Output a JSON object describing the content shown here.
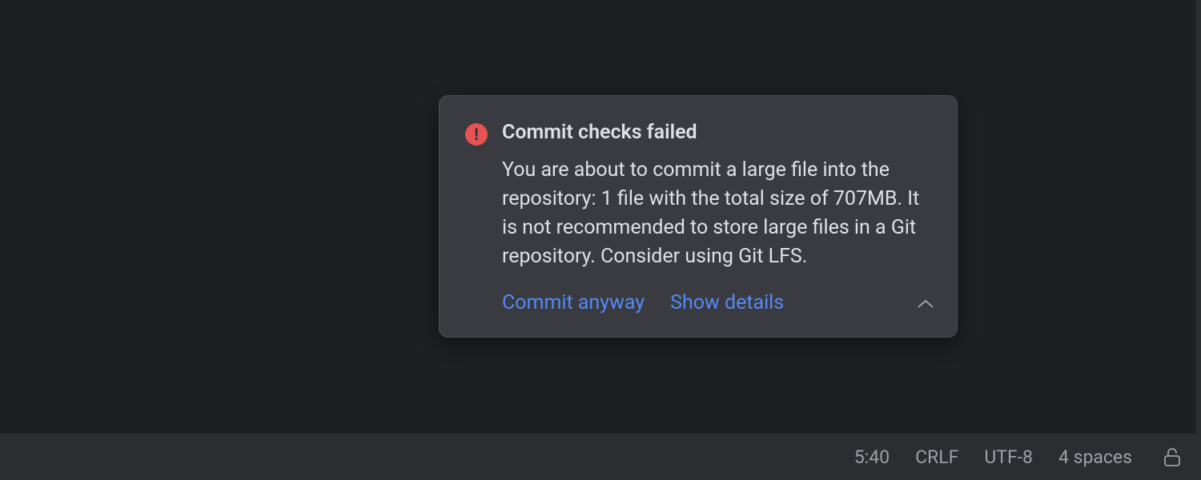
{
  "notification": {
    "title": "Commit checks failed",
    "body": "You are about to commit a large file into the repository: 1 file with the total size of 707MB. It is not recommended to store large files in a Git repository. Consider using Git LFS.",
    "actions": {
      "commit_anyway": "Commit anyway",
      "show_details": "Show details"
    }
  },
  "status_bar": {
    "cursor_position": "5:40",
    "line_separator": "CRLF",
    "encoding": "UTF-8",
    "indent": "4 spaces"
  },
  "colors": {
    "background": "#1e1f22",
    "panel": "#2b2d30",
    "notification_bg": "#393b40",
    "error": "#e55353",
    "link": "#548af7",
    "text": "#dfe1e5",
    "muted": "#9da0a8"
  }
}
